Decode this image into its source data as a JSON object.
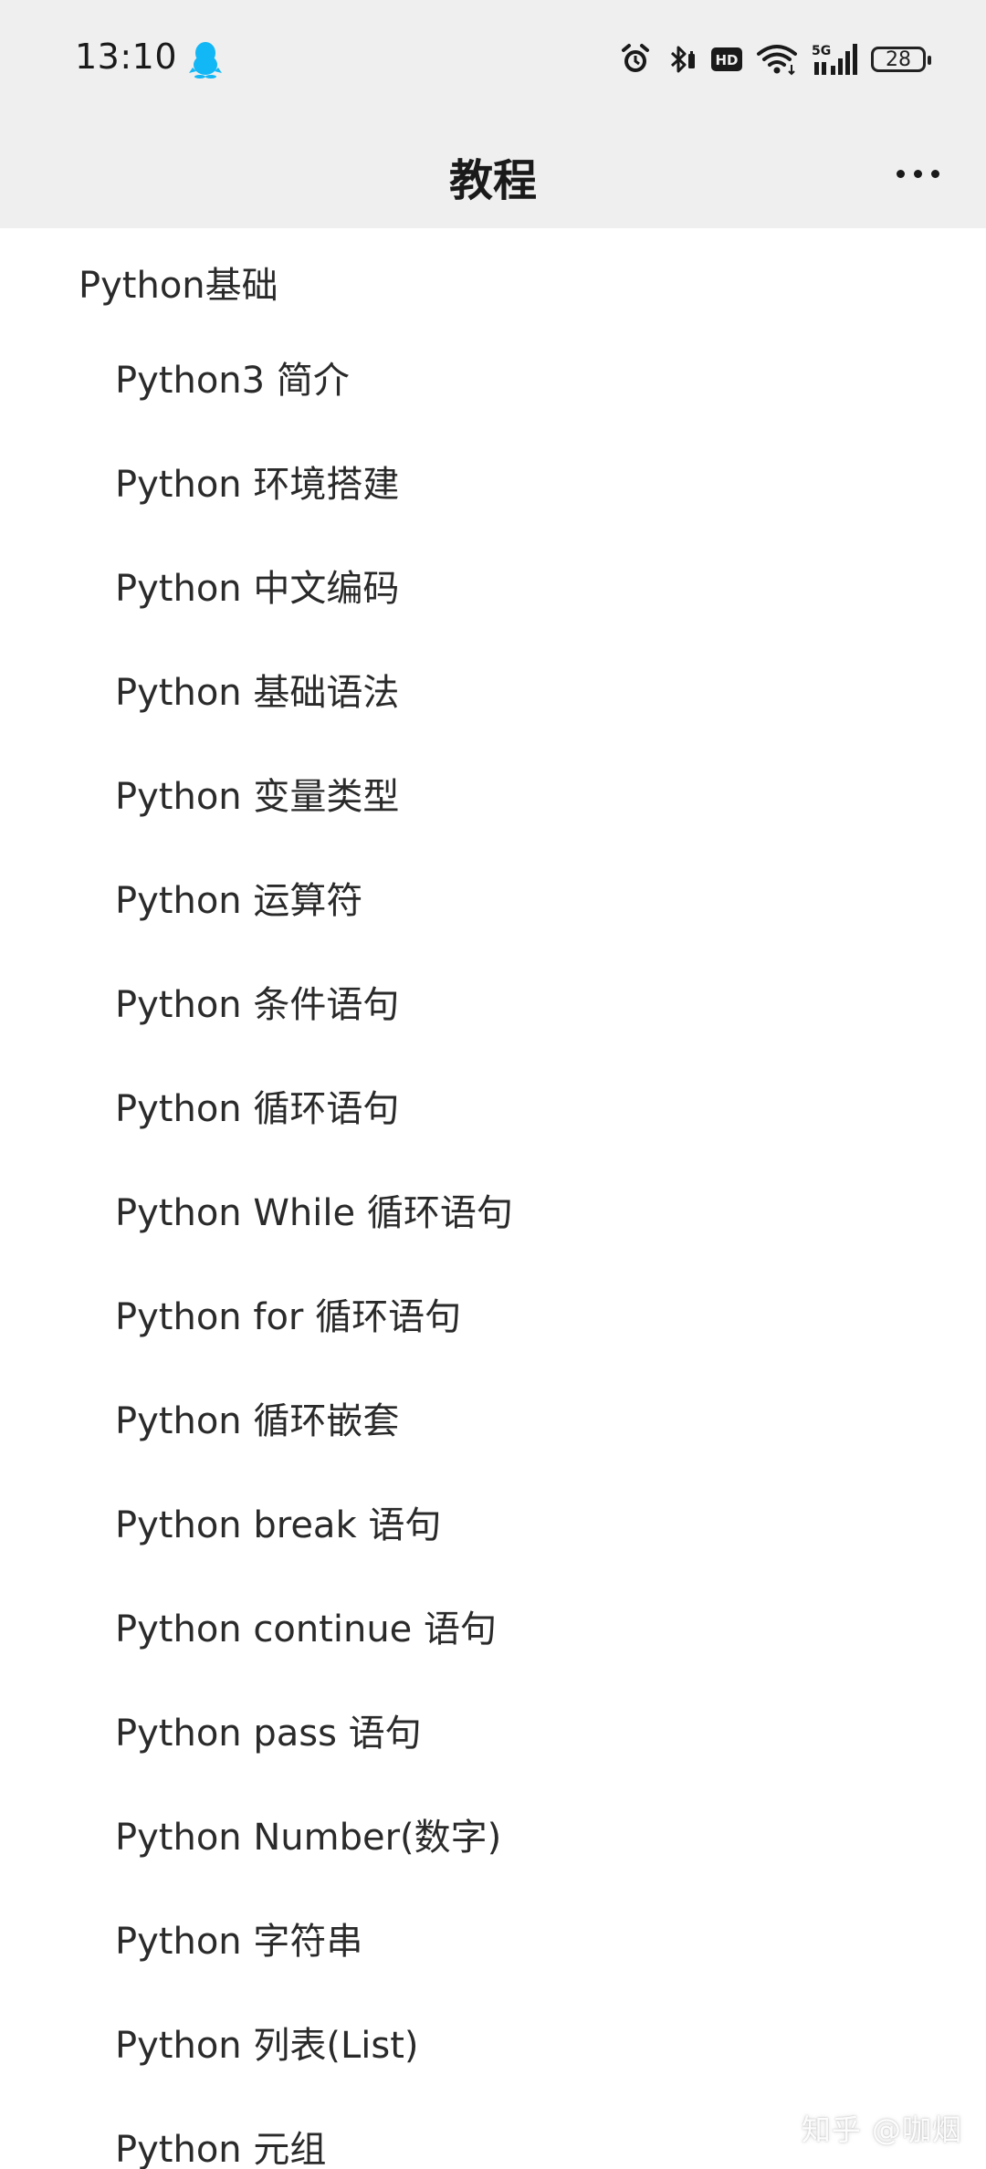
{
  "status_bar": {
    "time": "13:10",
    "network": "5G",
    "hd_label": "HD",
    "battery": "28",
    "icons": [
      "qq-icon",
      "alarm-icon",
      "bluetooth-icon",
      "hd-icon",
      "wifi-icon",
      "signal-5g-icon",
      "battery-icon"
    ]
  },
  "header": {
    "title": "教程",
    "more_icon": "more-dots-icon"
  },
  "toc": {
    "section_title": "Python基础",
    "items": [
      "Python3 简介",
      "Python 环境搭建",
      "Python 中文编码",
      "Python 基础语法",
      "Python 变量类型",
      "Python 运算符",
      "Python 条件语句",
      "Python 循环语句",
      "Python While 循环语句",
      "Python for 循环语句",
      "Python 循环嵌套",
      "Python break 语句",
      "Python continue 语句",
      "Python pass 语句",
      "Python Number(数字)",
      "Python 字符串",
      "Python 列表(List)",
      "Python 元组"
    ]
  },
  "watermark": "知乎 @咖烟"
}
